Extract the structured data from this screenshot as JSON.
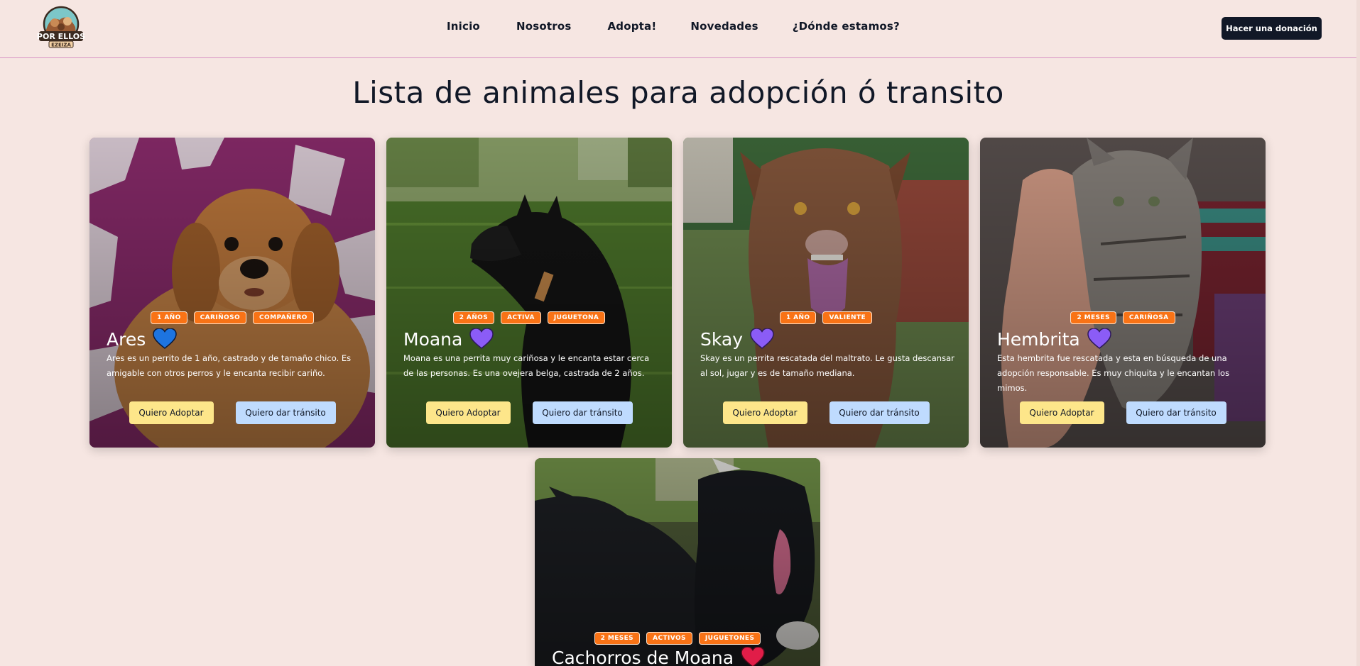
{
  "header": {
    "logo_text_main": "POR ELLOS",
    "logo_text_sub": "EZEIZA",
    "nav": [
      "Inicio",
      "Nosotros",
      "Adopta!",
      "Novedades",
      "¿Dónde estamos?"
    ],
    "donate_label": "Hacer una donación"
  },
  "main": {
    "title": "Lista de animales para adopción ó transito",
    "cards": [
      {
        "name": "Ares",
        "tags": [
          "1 año",
          "cariñoso",
          "compañero"
        ],
        "heart_color": "#1d74e0",
        "description": "Ares es un perrito de 1 año, castrado y de tamaño chico. Es amigable con otros perros y le encanta recibir cariño.",
        "adopt_label": "Quiero Adoptar",
        "transit_label": "Quiero dar tránsito"
      },
      {
        "name": "Moana",
        "tags": [
          "2 años",
          "activa",
          "juguetona"
        ],
        "heart_color": "#8b5cf6",
        "description": "Moana es una perrita muy cariñosa y le encanta estar cerca de las personas. Es una ovejera belga, castrada de 2 años.",
        "adopt_label": "Quiero Adoptar",
        "transit_label": "Quiero dar tránsito"
      },
      {
        "name": "Skay",
        "tags": [
          "1 año",
          "valiente"
        ],
        "heart_color": "#8b5cf6",
        "description": "Skay es un perrita rescatada del maltrato. Le gusta descansar al sol, jugar y es de tamaño mediana.",
        "adopt_label": "Quiero Adoptar",
        "transit_label": "Quiero dar tránsito"
      },
      {
        "name": "Hembrita",
        "tags": [
          "2 meses",
          "cariñosa"
        ],
        "heart_color": "#8b5cf6",
        "description": "Esta hembrita fue rescatada y esta en búsqueda de una adopción responsable. Es muy chiquita y le encantan los mimos.",
        "adopt_label": "Quiero Adoptar",
        "transit_label": "Quiero dar tránsito"
      },
      {
        "name": "Cachorros de Moana",
        "tags": [
          "2 meses",
          "activos",
          "juguetones"
        ],
        "heart_color": "#e11d48",
        "description": "",
        "adopt_label": "",
        "transit_label": ""
      }
    ]
  }
}
